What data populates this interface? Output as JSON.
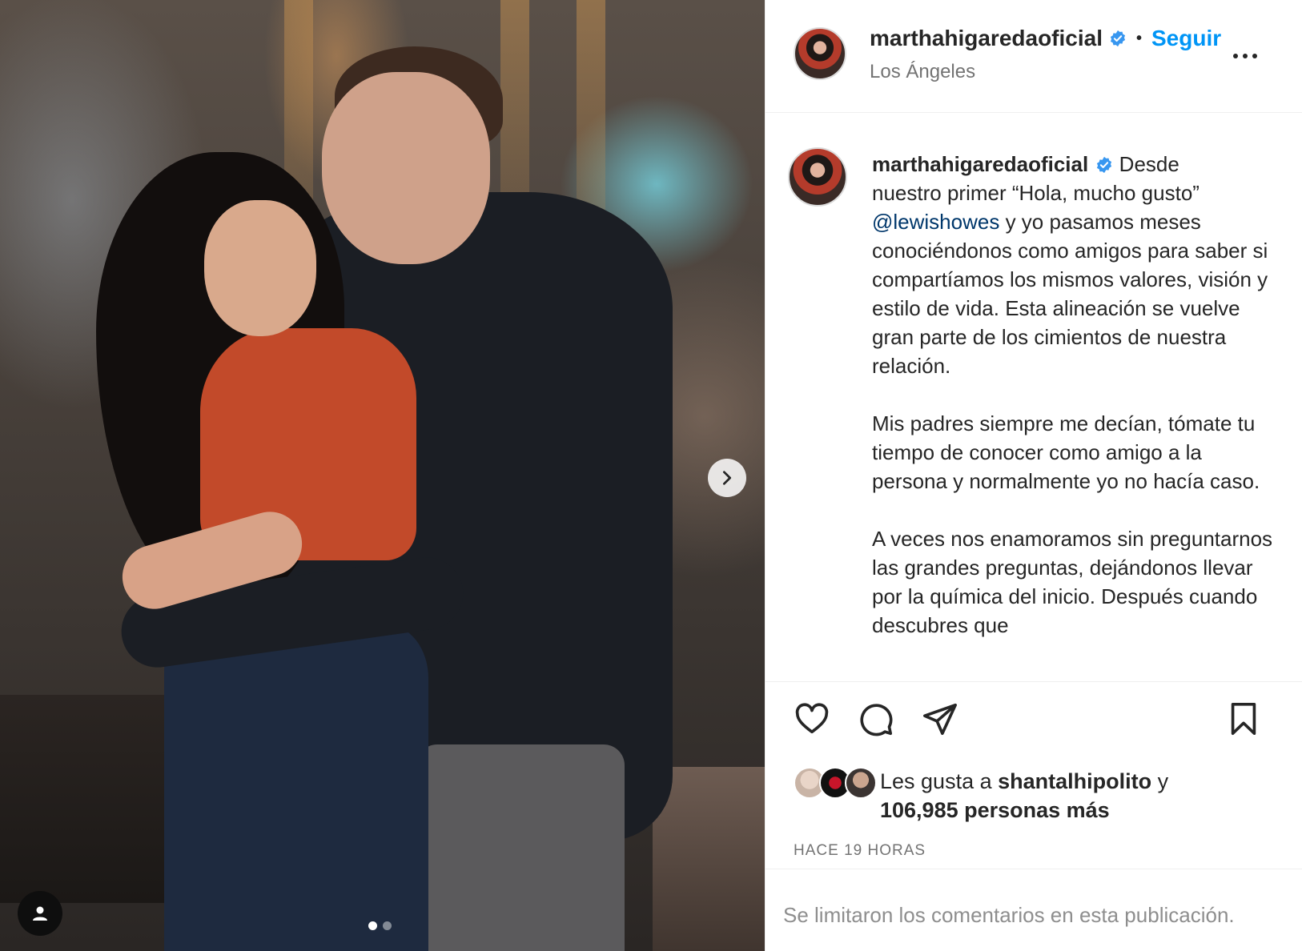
{
  "post": {
    "username": "marthahigaredaoficial",
    "separator": "•",
    "follow_label": "Seguir",
    "location": "Los Ángeles",
    "caption_paragraphs": [
      "nuestro primer “Hola, mucho gusto”",
      "y yo pasamos meses conociéndonos como amigos para saber si compartíamos los mismos valores, visión y estilo de vida. Esta alineación se vuelve gran parte de los cimientos de nuestra relación.",
      "Mis padres siempre me decían, tómate tu tiempo de conocer como amigo a la persona y normalmente yo no hacía caso.",
      "A veces nos enamoramos sin preguntarnos las grandes preguntas, dejándonos llevar por la química del inicio. Después cuando descubres que"
    ],
    "caption_first_word": "Desde",
    "mention": "@lewishowes",
    "likes_prefix": "Les gusta a",
    "likes_user": "shantalhipolito",
    "likes_and": "y",
    "likes_count_text": "106,985 personas más",
    "time_ago": "HACE 19 HORAS",
    "comments_limited": "Se limitaron los comentarios en esta publicación."
  },
  "carousel": {
    "total": 2,
    "current": 1
  },
  "icons": {
    "verified": "verified-badge-icon",
    "more": "more-options-icon",
    "like": "heart-icon",
    "comment": "comment-icon",
    "share": "send-icon",
    "save": "bookmark-icon",
    "next": "chevron-right-icon",
    "user_tag": "user-tag-icon"
  },
  "colors": {
    "accent": "#0095f6",
    "verified": "#3897f0",
    "mention": "#00376b",
    "muted": "#737373"
  }
}
